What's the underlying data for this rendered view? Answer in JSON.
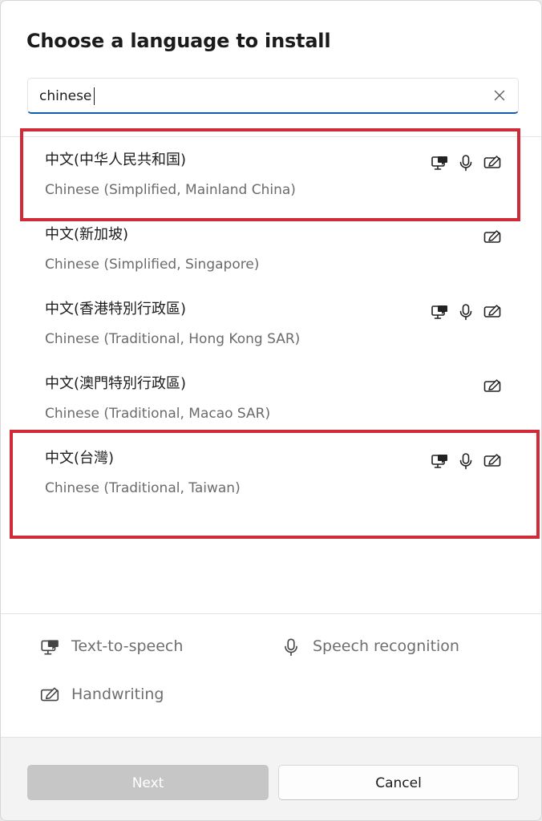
{
  "dialog": {
    "title": "Choose a language to install"
  },
  "search": {
    "value": "chinese",
    "placeholder": ""
  },
  "languages": [
    {
      "native": "中文(中华人民共和国)",
      "english": "Chinese (Simplified, Mainland China)",
      "features": [
        "text-to-speech",
        "speech-recognition",
        "handwriting"
      ]
    },
    {
      "native": "中文(新加坡)",
      "english": "Chinese (Simplified, Singapore)",
      "features": [
        "handwriting"
      ]
    },
    {
      "native": "中文(香港特別行政區)",
      "english": "Chinese (Traditional, Hong Kong SAR)",
      "features": [
        "text-to-speech",
        "speech-recognition",
        "handwriting"
      ]
    },
    {
      "native": "中文(澳門特別行政區)",
      "english": "Chinese (Traditional, Macao SAR)",
      "features": [
        "handwriting"
      ]
    },
    {
      "native": "中文(台灣)",
      "english": "Chinese (Traditional, Taiwan)",
      "features": [
        "text-to-speech",
        "speech-recognition",
        "handwriting"
      ]
    }
  ],
  "legend": {
    "text_to_speech": "Text-to-speech",
    "speech_recognition": "Speech recognition",
    "handwriting": "Handwriting"
  },
  "footer": {
    "next_label": "Next",
    "cancel_label": "Cancel"
  },
  "colors": {
    "accent": "#0f5ca8",
    "highlight": "#cf2a36",
    "disabled_button": "#c6c6c6"
  }
}
